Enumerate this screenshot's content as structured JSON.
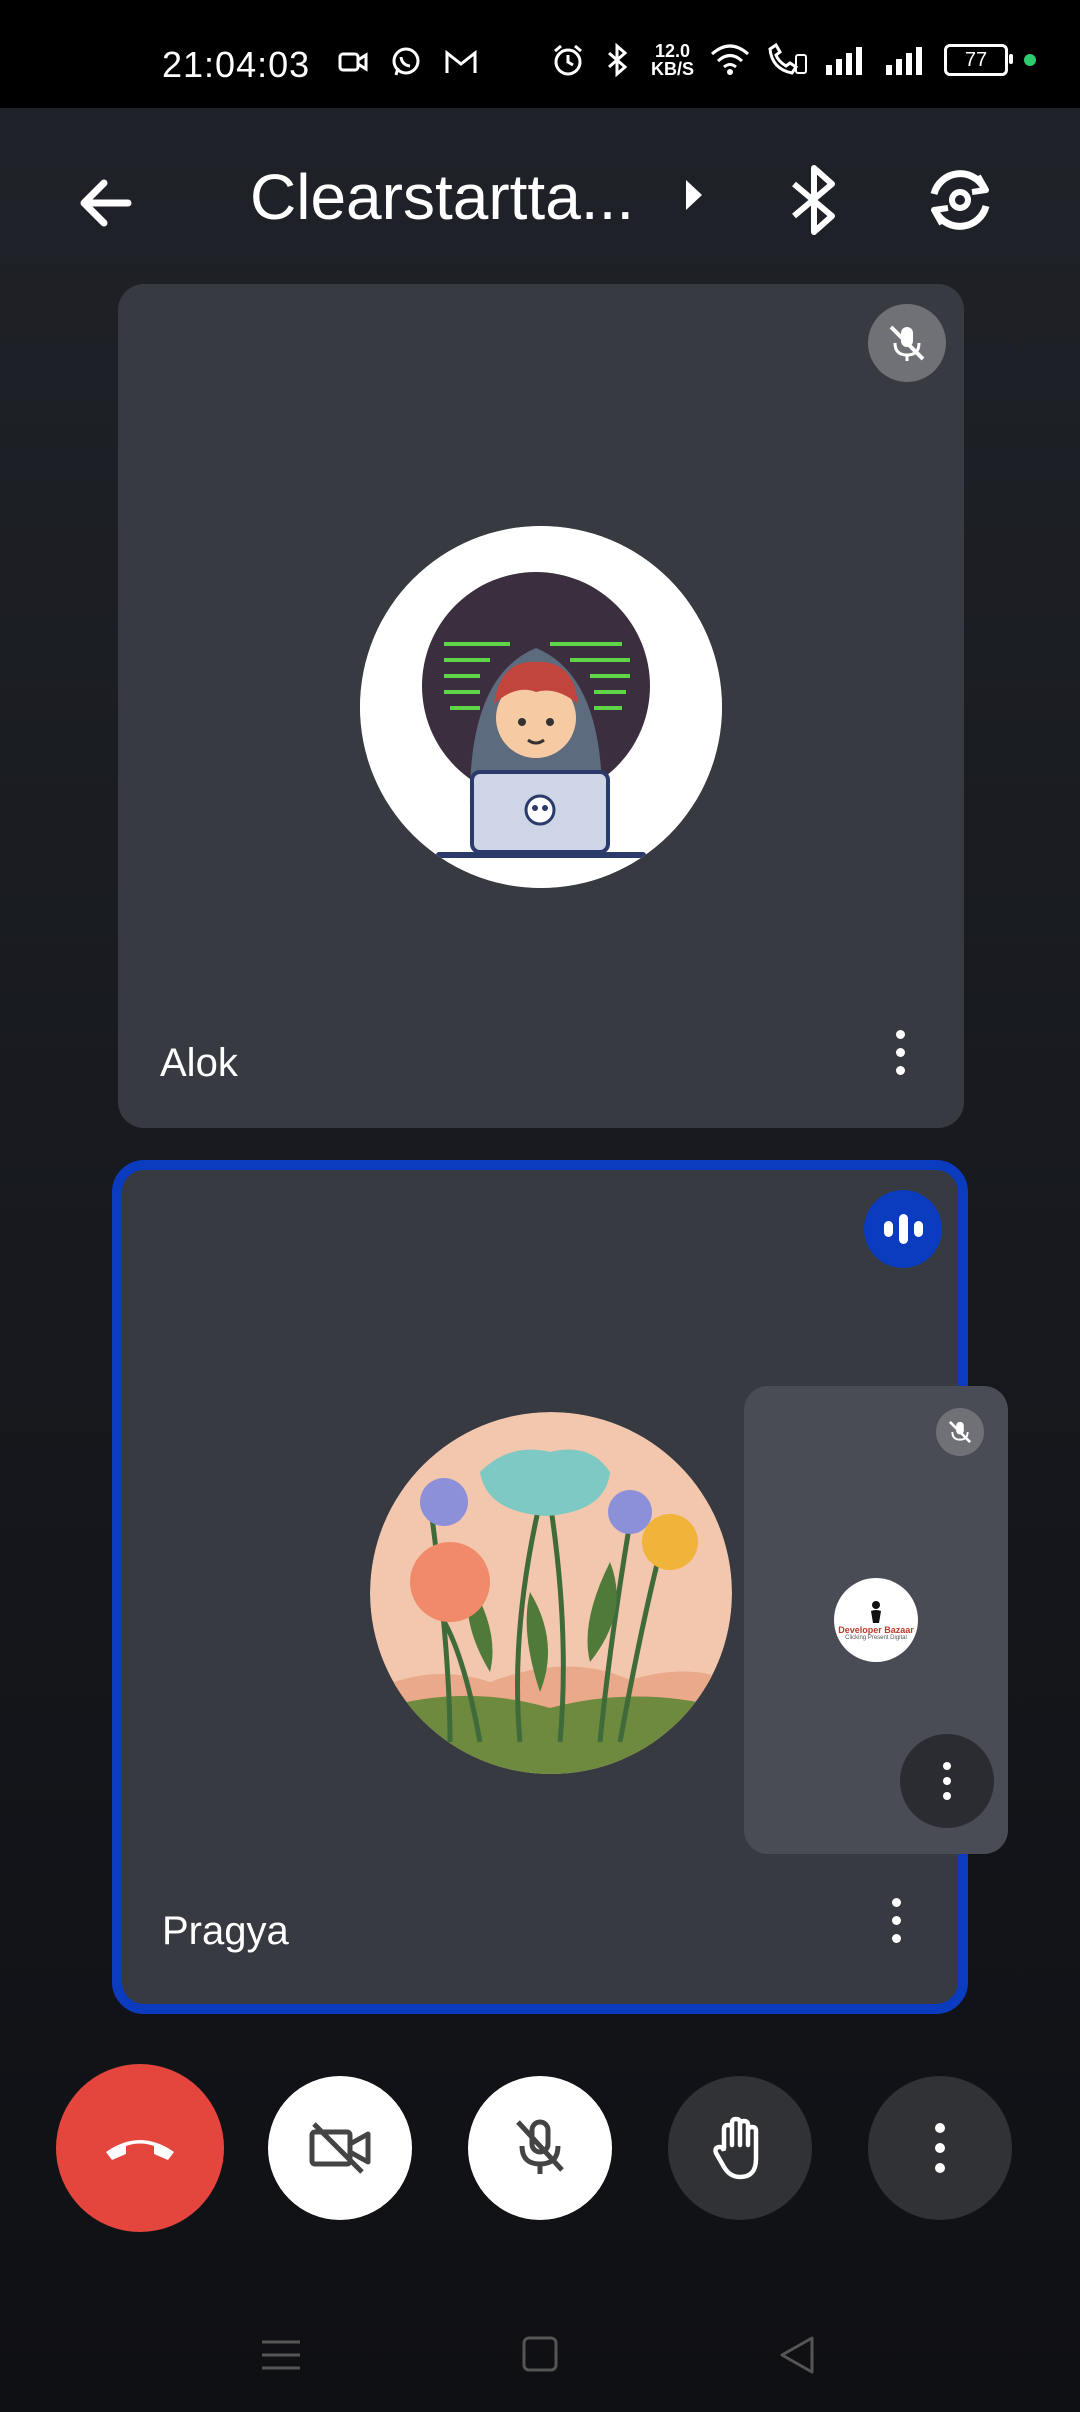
{
  "status_bar": {
    "time": "21:04:03",
    "net_speed_value": "12.0",
    "net_speed_unit": "KB/S",
    "battery_level": "77",
    "icons_left": [
      "video-call-icon",
      "whatsapp-icon",
      "gmail-icon"
    ],
    "icons_right": [
      "alarm-icon",
      "bluetooth-icon",
      "wifi-icon",
      "wifi-calling-icon",
      "signal-icon",
      "signal-icon",
      "battery-icon"
    ]
  },
  "header": {
    "meeting_title": "Clearstartta...",
    "icons": [
      "back-arrow-icon",
      "caret-right-icon",
      "bluetooth-icon",
      "switch-camera-icon"
    ]
  },
  "participants": [
    {
      "name": "Alok",
      "muted": true,
      "speaking": false,
      "avatar": "hacker-avatar"
    },
    {
      "name": "Pragya",
      "muted": false,
      "speaking": true,
      "avatar": "flowers-avatar"
    }
  ],
  "self_view": {
    "muted": true,
    "logo_text_line1": "Developer Bazaar",
    "logo_text_line2": "Clicking Present Digital"
  },
  "controls": [
    {
      "id": "end-call",
      "icon": "end-call-icon",
      "color": "#e4463e"
    },
    {
      "id": "camera",
      "icon": "camera-off-icon",
      "state": "off"
    },
    {
      "id": "mic",
      "icon": "mic-off-icon",
      "state": "off"
    },
    {
      "id": "raise-hand",
      "icon": "raise-hand-icon"
    },
    {
      "id": "more",
      "icon": "more-vertical-icon"
    }
  ],
  "colors": {
    "accent_blue": "#0b3bbf",
    "end_call_red": "#e4463e",
    "tile_bg": "#383a42"
  },
  "nav_bar": {
    "icons": [
      "menu-icon",
      "home-icon",
      "back-icon"
    ]
  }
}
